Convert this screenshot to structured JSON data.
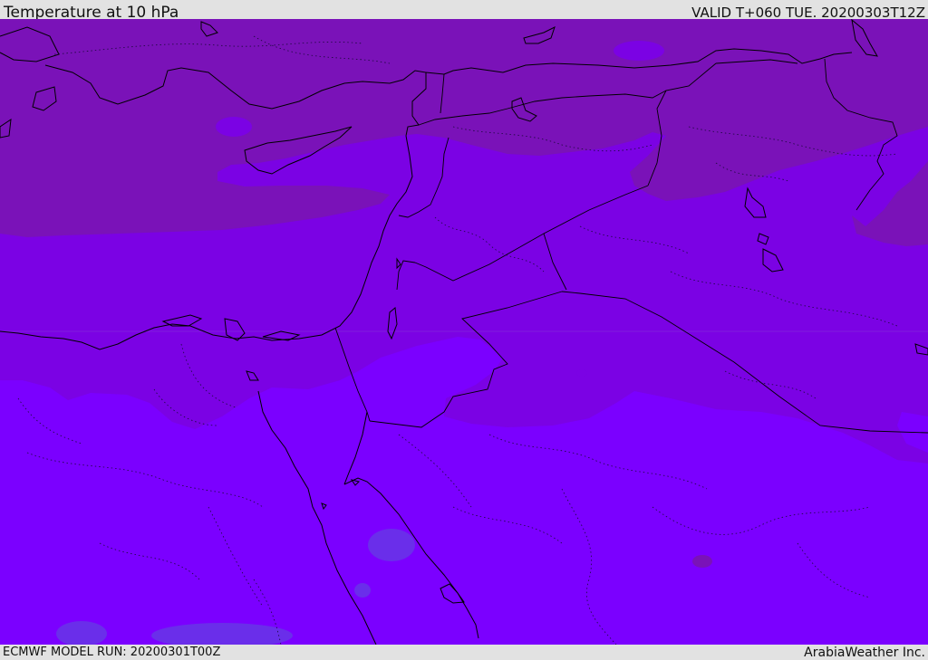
{
  "header": {
    "title": "Temperature at 10 hPa",
    "valid": "VALID T+060 TUE. 20200303T12Z"
  },
  "footer": {
    "model_run": "ECMWF MODEL RUN: 20200301T00Z",
    "credit": "ArabiaWeather Inc."
  },
  "map": {
    "field_colors": {
      "cold_band": "#7a12b8",
      "mid_band": "#7b02e4",
      "warm_band": "#7b00ff",
      "warm_patch": "#6a2eea"
    },
    "line_colors": {
      "coastline": "#000000",
      "border": "#000000",
      "admin": "#1a0a3a"
    }
  }
}
